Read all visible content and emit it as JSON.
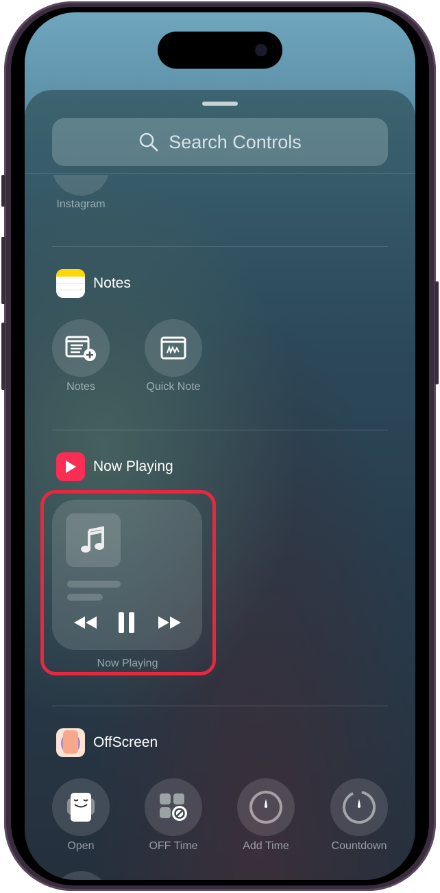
{
  "search": {
    "placeholder": "Search Controls",
    "icon": "magnifier-icon"
  },
  "partial_section": {
    "label": "Instagram"
  },
  "sections": [
    {
      "title": "Notes",
      "controls": [
        {
          "label": "Notes",
          "icon": "new-note-icon"
        },
        {
          "label": "Quick Note",
          "icon": "quick-note-icon"
        }
      ]
    },
    {
      "title": "Now Playing",
      "controls": [
        {
          "label": "Now Playing",
          "icon": "music-note-icon"
        }
      ]
    },
    {
      "title": "OffScreen",
      "controls": [
        {
          "label": "Open",
          "icon": "offscreen-face-icon"
        },
        {
          "label": "OFF Time",
          "icon": "apps-blocked-icon"
        },
        {
          "label": "Add Time",
          "icon": "timer-dial-icon"
        },
        {
          "label": "Countdown",
          "icon": "countdown-icon"
        }
      ]
    }
  ],
  "colors": {
    "highlight": "#e8283f",
    "now_playing_app": "#fa2d55",
    "notes_app": "#ffd60a"
  }
}
